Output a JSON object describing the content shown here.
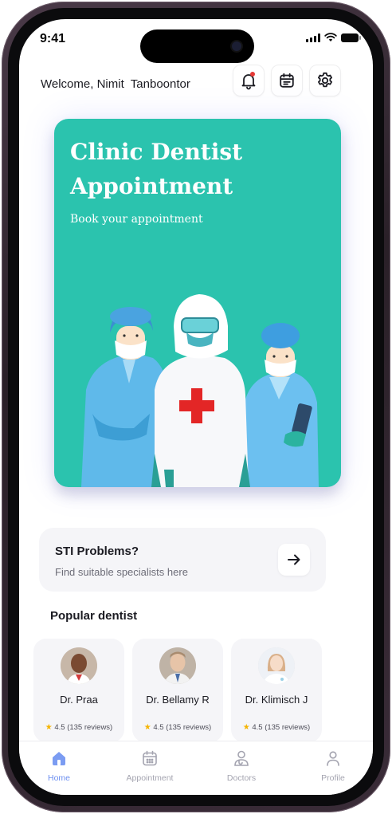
{
  "status_bar": {
    "time": "9:41"
  },
  "header": {
    "welcome_text": "Welcome, Nimit  Tanboontor",
    "icons": [
      "bell-icon",
      "calendar-icon",
      "gear-icon"
    ]
  },
  "hero": {
    "title": "Clinic Dentist Appointment",
    "subtitle": "Book your appointment",
    "background_color": "#2bc3ae"
  },
  "sti_card": {
    "title": "STI Problems?",
    "subtitle": "Find suitable specialists here",
    "icon": "arrow-right-icon"
  },
  "popular": {
    "title": "Popular dentist",
    "doctors": [
      {
        "name": "Dr. Praa",
        "rating": "4.5 (135 reviews)"
      },
      {
        "name": "Dr. Bellamy R",
        "rating": "4.5 (135 reviews)"
      },
      {
        "name": "Dr. Klimisch J",
        "rating": "4.5 (135 reviews)"
      }
    ]
  },
  "bottom_nav": {
    "items": [
      {
        "label": "Home",
        "icon": "home-icon",
        "active": true
      },
      {
        "label": "Appointment",
        "icon": "calendar-icon",
        "active": false
      },
      {
        "label": "Doctors",
        "icon": "stethoscope-icon",
        "active": false
      },
      {
        "label": "Profile",
        "icon": "user-icon",
        "active": false
      }
    ],
    "active_color": "#6d8ff0",
    "inactive_color": "#a4a4b0"
  }
}
